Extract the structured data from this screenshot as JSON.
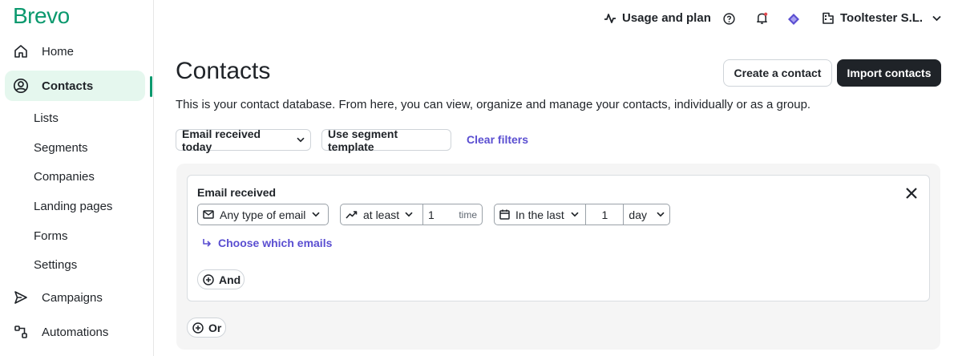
{
  "brand": {
    "logo_text": "Brevo",
    "accent": "#0b996e",
    "link_color": "#5a4ed1"
  },
  "sidebar": {
    "items": [
      {
        "label": "Home",
        "icon": "home-icon"
      },
      {
        "label": "Contacts",
        "icon": "contacts-icon",
        "active": true
      },
      {
        "label": "Lists"
      },
      {
        "label": "Segments"
      },
      {
        "label": "Companies"
      },
      {
        "label": "Landing pages"
      },
      {
        "label": "Forms"
      },
      {
        "label": "Settings"
      },
      {
        "label": "Campaigns",
        "icon": "send-icon"
      },
      {
        "label": "Automations",
        "icon": "automation-icon"
      }
    ]
  },
  "topbar": {
    "usage_label": "Usage and plan",
    "account_label": "Tooltester S.L."
  },
  "main": {
    "title": "Contacts",
    "create_label": "Create a contact",
    "import_label": "Import contacts",
    "description": "This is your contact database. From here, you can view, organize and manage your contacts, individually or as a group.",
    "filter_label": "Email received today",
    "segment_label": "Use segment template",
    "clear_label": "Clear filters"
  },
  "condition": {
    "title": "Email received",
    "email_type": "Any type of email",
    "comparator": "at least",
    "count_value": "1",
    "count_unit": "time",
    "period_label": "In the last",
    "period_value": "1",
    "period_unit": "day",
    "choose_label": "Choose which emails",
    "and_label": "And",
    "or_label": "Or"
  }
}
